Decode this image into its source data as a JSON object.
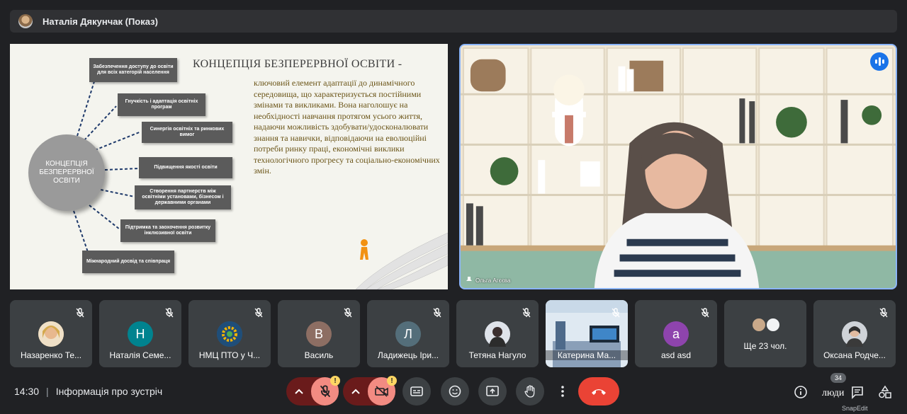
{
  "presenter": {
    "title": "Наталія Дякунчак (Показ)"
  },
  "slide": {
    "center": "КОНЦЕПЦІЯ БЕЗПЕРЕРВНОЇ ОСВІТИ",
    "title": "КОНЦЕПЦІЯ БЕЗПЕРЕРВНОЇ ОСВІТИ -",
    "body": "ключовий елемент адаптації до динамічного середовища, що характеризується постійними змінами та викликами. Вона наголошує на необхідності навчання протягом усього життя, надаючи можливість здобувати/удосконалювати знання та навички, відповідаючи на еволюційні потреби ринку праці, економічні виклики технологічного прогресу та соціально-економічних змін.",
    "boxes": [
      "Забезпечення доступу до освіти для всіх категорій населення",
      "Гнучкість і адаптація освітніх програм",
      "Синергія освітніх та ринкових вимог",
      "Підвищення якості освіти",
      "Створення партнерств між освітніми установами, бізнесом і державними органами",
      "Підтримка та заохочення розвитку інклюзивної освіти",
      "Міжнародний досвід та співпраця"
    ]
  },
  "speaker": {
    "name": "Ольга Агєєва"
  },
  "participants": [
    {
      "name": "Назаренко Те...",
      "initial": "",
      "color": "#c9a76a"
    },
    {
      "name": "Наталія Семе...",
      "initial": "Н",
      "color": "#00838f"
    },
    {
      "name": "НМЦ ПТО у Ч...",
      "initial": "",
      "color": "#2d5f8a"
    },
    {
      "name": "Василь",
      "initial": "В",
      "color": "#8d6e63"
    },
    {
      "name": "Ладижець Іри...",
      "initial": "Л",
      "color": "#546e7a"
    },
    {
      "name": "Тетяна Нагуло",
      "initial": "",
      "color": "#6d6d6d"
    },
    {
      "name": "Катерина Ма...",
      "initial": "",
      "color": "#5a7da6"
    },
    {
      "name": "asd asd",
      "initial": "a",
      "color": "#8e44ad"
    },
    {
      "name": "Ще 23 чол.",
      "initial": "",
      "color": "#5f6368"
    },
    {
      "name": "Оксана Родче...",
      "initial": "",
      "color": "#6d6d6d"
    }
  ],
  "footer": {
    "time": "14:30",
    "meeting_info": "Інформація про зустріч",
    "people_label": "люди",
    "people_count": "34",
    "watermark": "SnapEdit",
    "alert_badge": "!"
  },
  "colors": {
    "end_call": "#ea4335",
    "accent": "#8ab4f8",
    "alert": "#fdd663"
  }
}
